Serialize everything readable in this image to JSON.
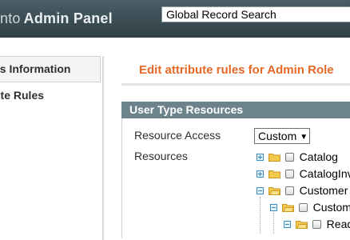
{
  "header": {
    "brand": "nto",
    "title": "Admin Panel",
    "search_value": "Global Record Search"
  },
  "sidebar": {
    "tabs": [
      {
        "label": "es Information"
      },
      {
        "label": "ute Rules"
      }
    ]
  },
  "main": {
    "title": "Edit attribute rules for Admin Role"
  },
  "section": {
    "title": "User Type Resources",
    "resource_access_label": "Resource Access",
    "resource_access_value": "Custom",
    "resources_label": "Resources"
  },
  "tree": {
    "items": [
      {
        "label": "Catalog",
        "toggle": "plus",
        "checked": false
      },
      {
        "label": "CatalogInve",
        "toggle": "plus",
        "checked": false
      },
      {
        "label": "Customer",
        "toggle": "minus",
        "checked": false
      },
      {
        "label": "Custome",
        "toggle": "minus",
        "checked": false
      },
      {
        "label": "Read",
        "toggle": "minus",
        "checked": false
      }
    ]
  },
  "colors": {
    "header_bg": "#3d4d54",
    "accent_orange": "#e76826",
    "section_bg": "#6d838c",
    "tree_toggle": "#3a8cc5",
    "folder": "#f2c94c"
  }
}
